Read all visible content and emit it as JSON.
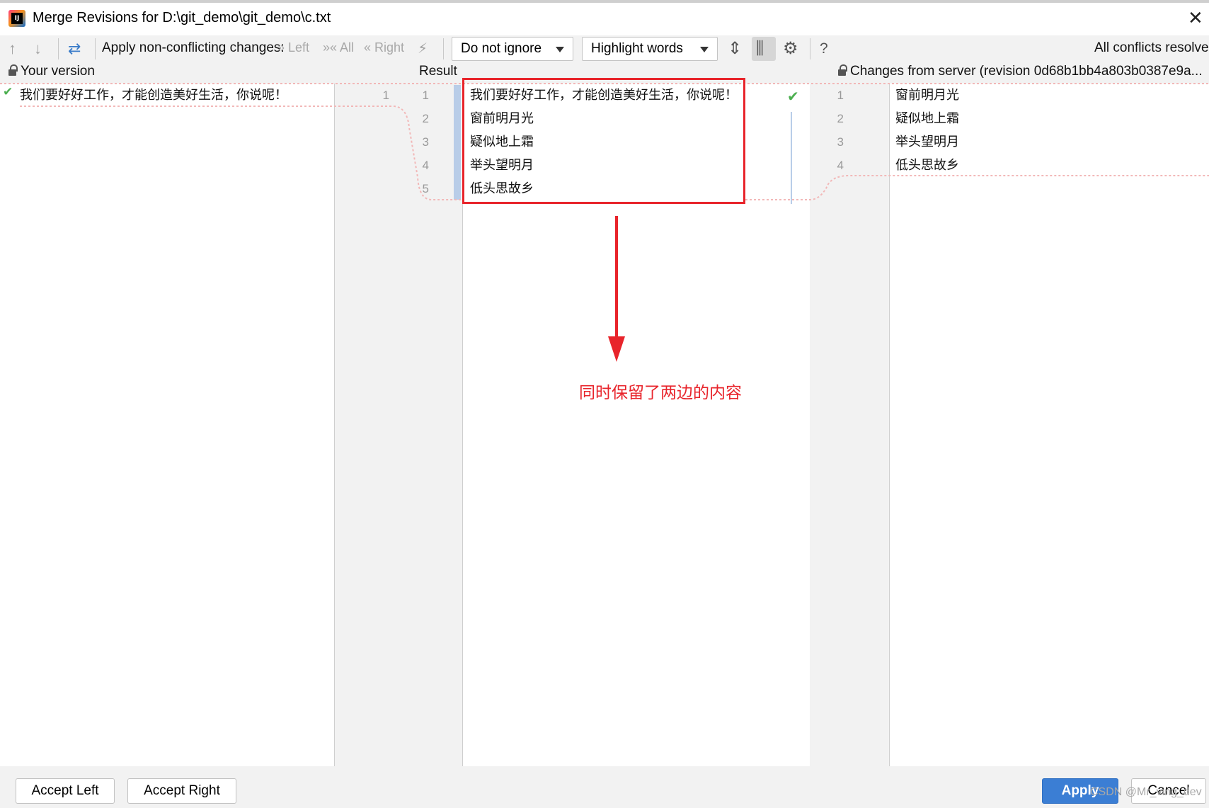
{
  "window": {
    "title": "Merge Revisions for D:\\git_demo\\git_demo\\c.txt"
  },
  "toolbar": {
    "apply_label": "Apply non-conflicting changes:",
    "left_label": "Left",
    "all_label": "All",
    "right_label": "Right",
    "ignore_dropdown": "Do not ignore",
    "highlight_dropdown": "Highlight words",
    "help_label": "?",
    "status": "All conflicts resolve"
  },
  "panes": {
    "left": {
      "header": "Your version",
      "lines": [
        "我们要好好工作，才能创造美好生活，你说呢！"
      ]
    },
    "center": {
      "header": "Result",
      "left_numbers": [
        "1"
      ],
      "right_numbers": [
        "1",
        "2",
        "3",
        "4",
        "5"
      ],
      "lines": [
        "我们要好好工作，才能创造美好生活，你说呢！",
        "窗前明月光",
        "疑似地上霜",
        "举头望明月",
        "低头思故乡"
      ]
    },
    "right": {
      "header": "Changes from server (revision 0d68b1bb4a803b0387e9a...",
      "numbers": [
        "1",
        "2",
        "3",
        "4"
      ],
      "lines": [
        "窗前明月光",
        "疑似地上霜",
        "举头望明月",
        "低头思故乡"
      ]
    }
  },
  "annotation": {
    "text": "同时保留了两边的内容",
    "color": "#e8242b"
  },
  "footer": {
    "accept_left": "Accept Left",
    "accept_right": "Accept Right",
    "apply": "Apply",
    "cancel": "Cancel",
    "watermark": "CSDN @Mr_ving_dev"
  },
  "colors": {
    "accent": "#3b7ed4",
    "resolved": "#4caf50",
    "conflict_dots": "#f2b8b8"
  }
}
